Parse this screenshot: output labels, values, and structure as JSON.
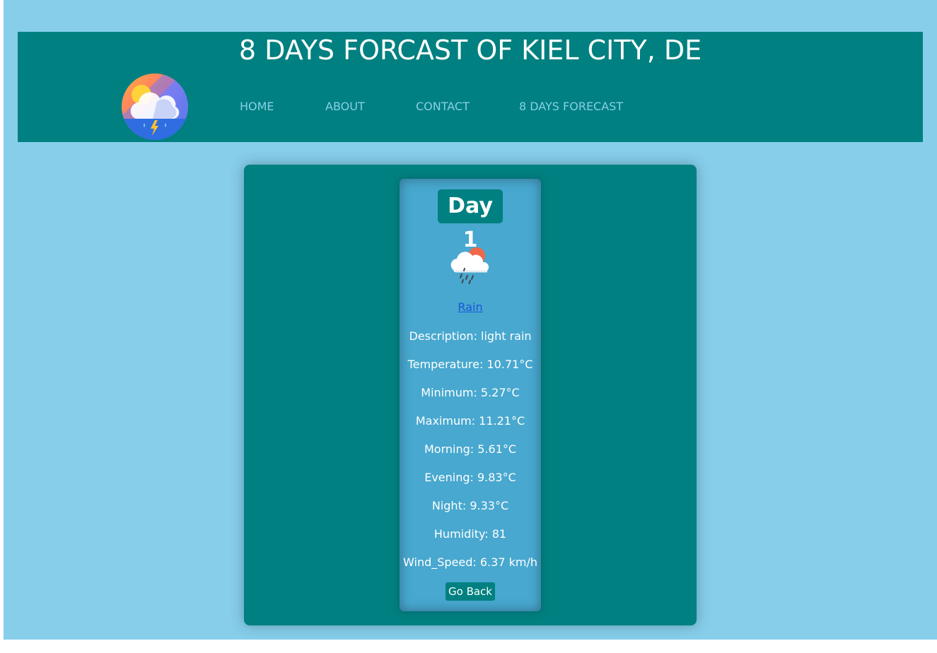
{
  "header": {
    "title": "8 DAYS FORCAST OF KIEL CITY, DE",
    "logo_icon": "storm-cloud-sun-icon",
    "nav": [
      {
        "label": "HOME"
      },
      {
        "label": "ABOUT"
      },
      {
        "label": "CONTACT"
      },
      {
        "label": "8 DAYS FORECAST"
      }
    ]
  },
  "card": {
    "day_title": "Day 1",
    "weather_icon": "rain-cloud-sun-icon",
    "main": "Rain",
    "rows": [
      "Description: light rain",
      "Temperature: 10.71°C",
      "Minimum: 5.27°C",
      "Maximum: 11.21°C",
      "Morning: 5.61°C",
      "Evening: 9.83°C",
      "Night: 9.33°C",
      "Humidity: 81",
      "Wind_Speed: 6.37 km/h"
    ],
    "go_back_label": "Go Back"
  },
  "colors": {
    "page_bg": "#87ceeb",
    "teal": "#008080",
    "card_bg": "#48a8cf",
    "nav_text": "#87ceeb",
    "link": "#1a57d6"
  }
}
